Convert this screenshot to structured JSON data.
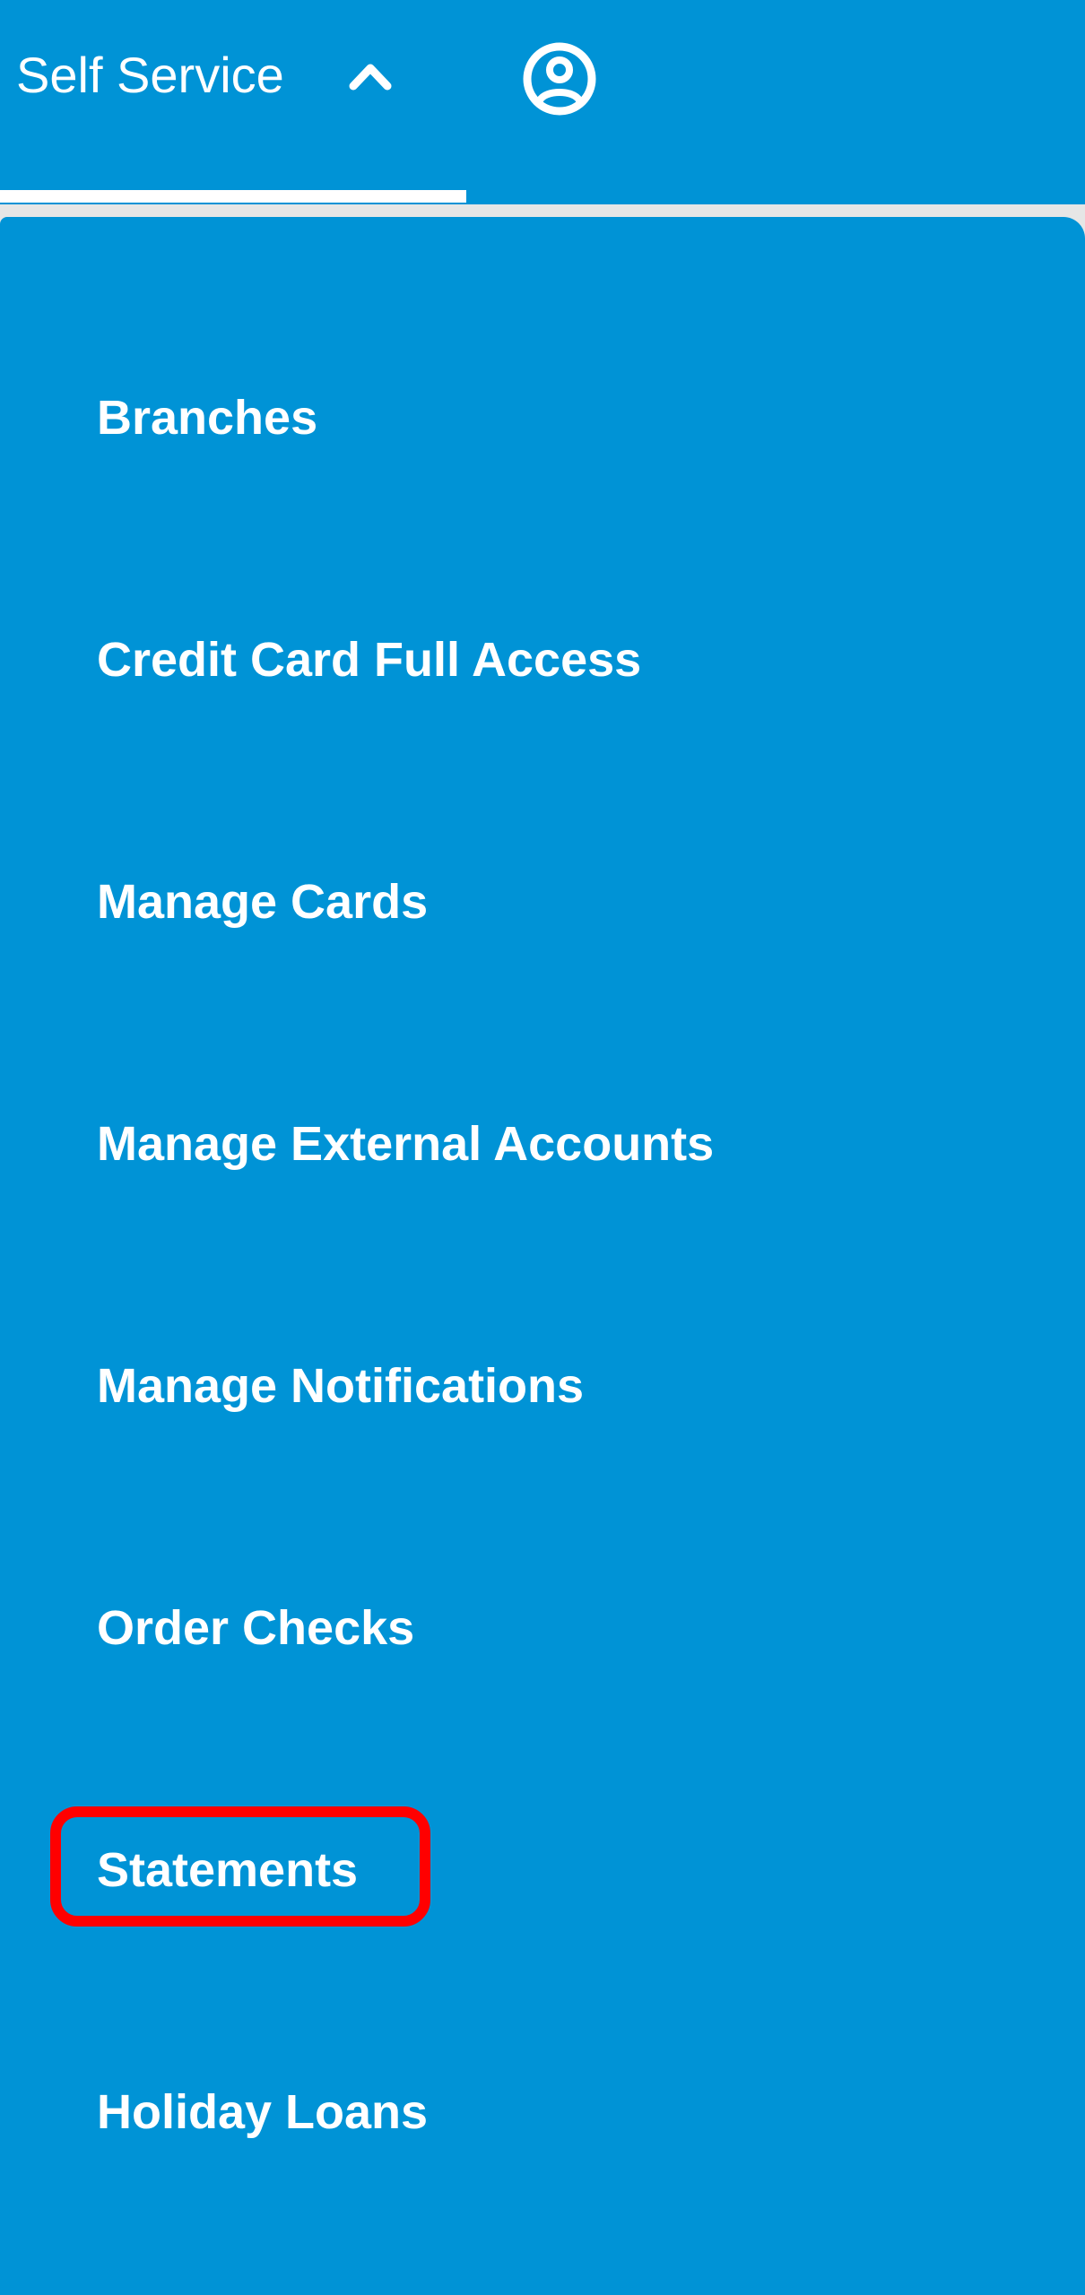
{
  "header": {
    "nav_label": "Self Service",
    "nav_state_icon": "chevron-up-icon",
    "profile_icon": "user-circle-icon"
  },
  "colors": {
    "brand_blue": "#0093d6",
    "text": "#ffffff",
    "highlight": "#ff0000",
    "gap": "#e6e6e6"
  },
  "menu": {
    "items": [
      {
        "label": "Branches"
      },
      {
        "label": "Credit Card Full Access"
      },
      {
        "label": "Manage Cards"
      },
      {
        "label": "Manage External Accounts"
      },
      {
        "label": "Manage Notifications"
      },
      {
        "label": "Order Checks"
      },
      {
        "label": "Statements",
        "highlighted": true
      },
      {
        "label": "Holiday Loans"
      }
    ]
  }
}
